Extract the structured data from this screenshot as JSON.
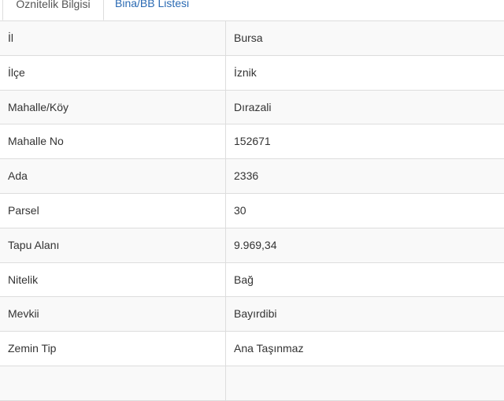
{
  "tabs": [
    {
      "label": "Öznitelik Bilgisi",
      "active": true
    },
    {
      "label": "Bina/BB Listesi",
      "active": false
    }
  ],
  "rows": [
    {
      "label": "İl",
      "value": "Bursa"
    },
    {
      "label": "İlçe",
      "value": "İznik"
    },
    {
      "label": "Mahalle/Köy",
      "value": "Dırazali"
    },
    {
      "label": "Mahalle No",
      "value": "152671"
    },
    {
      "label": "Ada",
      "value": "2336"
    },
    {
      "label": "Parsel",
      "value": "30"
    },
    {
      "label": "Tapu Alanı",
      "value": "9.969,34"
    },
    {
      "label": "Nitelik",
      "value": "Bağ"
    },
    {
      "label": "Mevkii",
      "value": "Bayırdibi"
    },
    {
      "label": "Zemin Tip",
      "value": "Ana Taşınmaz"
    },
    {
      "label": "",
      "value": ""
    }
  ]
}
